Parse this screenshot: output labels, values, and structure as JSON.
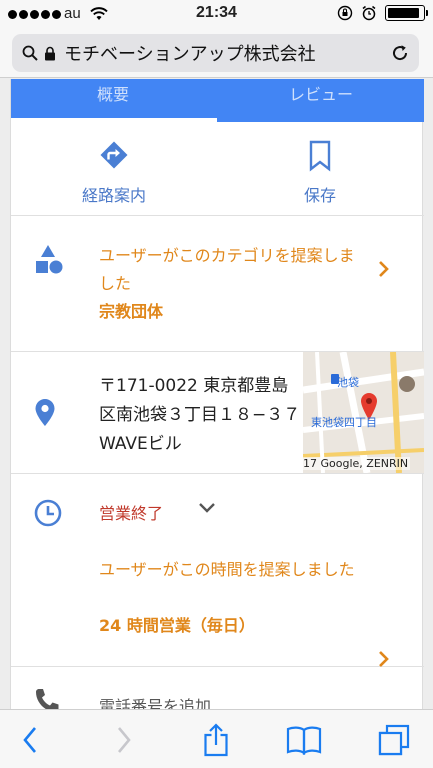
{
  "status_bar": {
    "carrier": "au",
    "time": "21:34",
    "battery_level": 0.9,
    "icons": [
      "signal-dots-icon",
      "wifi-icon",
      "orientation-lock-icon",
      "alarm-icon",
      "battery-icon"
    ]
  },
  "browser": {
    "page_title": "モチベーションアップ株式会社",
    "icons": [
      "search-icon",
      "lock-icon",
      "reload-icon"
    ]
  },
  "tabs": [
    {
      "label": "概要",
      "selected": true
    },
    {
      "label": "レビュー",
      "selected": false
    }
  ],
  "actions": [
    {
      "label": "経路案内",
      "icon": "directions-icon"
    },
    {
      "label": "保存",
      "icon": "bookmark-icon"
    }
  ],
  "category": {
    "suggestion": "ユーザーがこのカテゴリを提案しました",
    "value": "宗教団体",
    "icon": "category-shapes-icon"
  },
  "address": {
    "text": "〒171-0022 東京都豊島区南池袋３丁目１８−３７ WAVEビル",
    "icon": "location-pin-icon",
    "map": {
      "copyright": "17 Google, ZENRIN",
      "poi_1": "池袋",
      "poi_2": "東池袋四丁目"
    }
  },
  "hours": {
    "status": "営業終了",
    "suggestion": "ユーザーがこの時間を提案しました",
    "value": "24 時間営業（毎日）",
    "icon": "clock-icon"
  },
  "phone": {
    "label": "電話番号を追加",
    "icon": "phone-icon"
  },
  "colors": {
    "accent_blue": "#4285f4",
    "suggestion_orange": "#e0871b",
    "closed_red": "#c0392b",
    "ios_blue": "#1a7cf0"
  },
  "toolbar": {
    "icons": [
      "back-icon",
      "forward-icon",
      "share-icon",
      "bookmarks-icon",
      "tabs-icon"
    ]
  }
}
